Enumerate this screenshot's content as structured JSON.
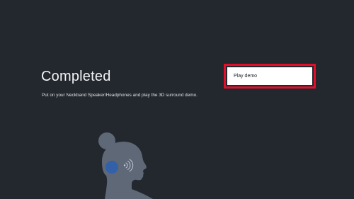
{
  "screen": {
    "title": "Completed",
    "description": "Put on your Neckband Speaker/Headphones and play the 3D surround demo."
  },
  "play_button": {
    "label": "Play demo",
    "focus_color": "#e0102a"
  },
  "illustration": {
    "icon": "person-with-headphones-icon"
  },
  "colors": {
    "background": "#23272e",
    "text": "#f2f3f5",
    "button_bg": "#ffffff",
    "figure": "#5f6877",
    "ear_highlight": "#2d5fae"
  }
}
